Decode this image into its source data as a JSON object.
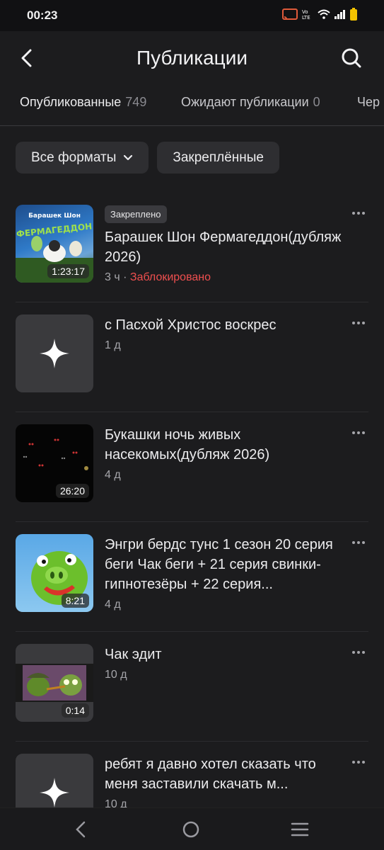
{
  "status_bar": {
    "time": "00:23"
  },
  "header": {
    "title": "Публикации"
  },
  "tabs": [
    {
      "label": "Опубликованные",
      "count": "749"
    },
    {
      "label": "Ожидают публикации",
      "count": "0"
    },
    {
      "label": "Чер",
      "count": ""
    }
  ],
  "filters": {
    "formats_label": "Все форматы",
    "pinned_label": "Закреплённые"
  },
  "items": [
    {
      "badge": "Закреплено",
      "title": "Барашек Шон Фермагеддон(дубляж 2026)",
      "age": "3 ч",
      "status": "Заблокировано",
      "duration": "1:23:17"
    },
    {
      "title": "с Пасхой Христос воскрес",
      "age": "1 д"
    },
    {
      "title": "Букашки ночь живых насекомых(дубляж 2026)",
      "age": "4 д",
      "duration": "26:20"
    },
    {
      "title": "Энгри бердс тунс 1 сезон 20 серия беги Чак беги + 21 серия свинки-гипнотезёры + 22 серия...",
      "age": "4 д",
      "duration": "8:21"
    },
    {
      "title": "Чак эдит",
      "age": "10 д",
      "duration": "0:14"
    },
    {
      "title": "ребят я давно хотел сказать что меня заставили скачать м...",
      "age": "10 д"
    }
  ],
  "colors": {
    "background": "#1c1c1e",
    "blocked": "#ef4f4f",
    "chip": "#2e2e31"
  },
  "icons": {
    "back": "arrow-left-icon",
    "search": "search-icon",
    "chevron": "chevron-down-icon",
    "more": "more-horizontal-icon",
    "placeholder": "sparkle-icon"
  }
}
